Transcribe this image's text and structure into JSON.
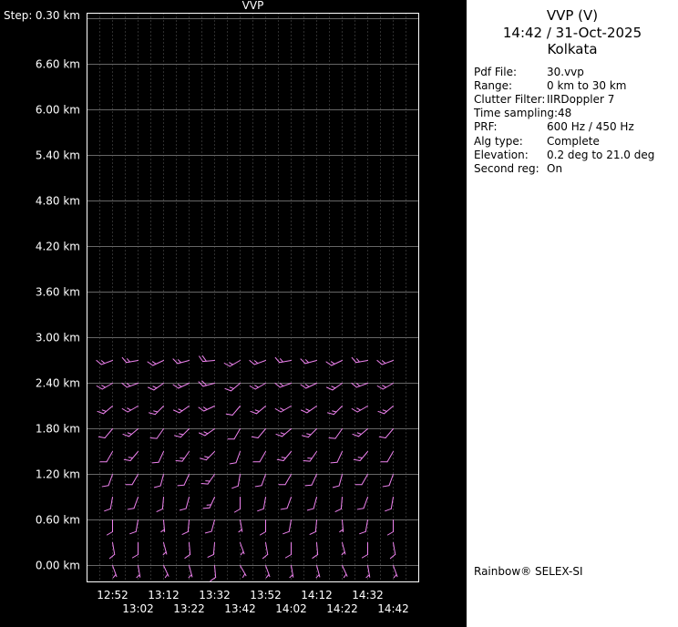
{
  "right_panel": {
    "title": "VVP (V)",
    "datetime": "14:42 / 31-Oct-2025",
    "station": "Kolkata",
    "info": {
      "rows": [
        {
          "label": "Pdf File:",
          "value": "30.vvp"
        },
        {
          "label": "Range:",
          "value": "0 km to 30 km"
        },
        {
          "label": "Clutter Filter:",
          "value": "IIRDoppler 7"
        },
        {
          "label": "Time sampling:",
          "value": "48"
        },
        {
          "label": "PRF:",
          "value": "600 Hz / 450 Hz"
        },
        {
          "label": "Alg type:",
          "value": "Complete"
        },
        {
          "label": "Elevation:",
          "value": "0.2 deg to 21.0 deg"
        },
        {
          "label": "Second reg:",
          "value": "On"
        }
      ]
    },
    "footer": "Rainbow® SELEX-SI"
  },
  "chart_data": {
    "type": "wind-barb-profile",
    "title": "VVP",
    "step_label": "Step:",
    "step_value": "0.30 km",
    "y_unit": "km",
    "y_ticks_km": [
      6.6,
      6.0,
      5.4,
      4.8,
      4.2,
      3.6,
      3.0,
      2.4,
      1.8,
      1.2,
      0.6,
      0.0
    ],
    "ylim_km": [
      -0.2,
      7.3
    ],
    "grid": {
      "horizontal_step_km": 0.6,
      "vertical_step_minutes": 5,
      "grid_on": true
    },
    "x_times": [
      "12:52",
      "13:02",
      "13:12",
      "13:22",
      "13:32",
      "13:42",
      "13:52",
      "14:02",
      "14:12",
      "14:22",
      "14:32",
      "14:42"
    ],
    "x_step_minutes": 10,
    "barb_color": "#f083f0",
    "barb_units": "each barb = [direction_deg, speed_kt] (estimated)",
    "series": [
      {
        "height_km": 0.0,
        "barbs": [
          [
            160,
            5
          ],
          [
            170,
            7
          ],
          [
            155,
            4
          ],
          [
            165,
            6
          ],
          [
            175,
            8
          ],
          [
            150,
            3
          ],
          [
            160,
            5
          ],
          [
            170,
            7
          ],
          [
            165,
            6
          ],
          [
            155,
            4
          ],
          [
            170,
            7
          ],
          [
            160,
            5
          ]
        ]
      },
      {
        "height_km": 0.3,
        "barbs": [
          [
            170,
            8
          ],
          [
            180,
            10
          ],
          [
            165,
            7
          ],
          [
            175,
            9
          ],
          [
            185,
            11
          ],
          [
            160,
            6
          ],
          [
            170,
            8
          ],
          [
            180,
            10
          ],
          [
            175,
            9
          ],
          [
            165,
            7
          ],
          [
            180,
            10
          ],
          [
            170,
            8
          ]
        ]
      },
      {
        "height_km": 0.6,
        "barbs": [
          [
            180,
            8
          ],
          [
            190,
            10
          ],
          [
            175,
            7
          ],
          [
            185,
            9
          ],
          [
            195,
            11
          ],
          [
            170,
            6
          ],
          [
            180,
            8
          ],
          [
            190,
            10
          ],
          [
            185,
            9
          ],
          [
            175,
            7
          ],
          [
            190,
            10
          ],
          [
            180,
            8
          ]
        ]
      },
      {
        "height_km": 0.9,
        "barbs": [
          [
            190,
            10
          ],
          [
            200,
            12
          ],
          [
            185,
            9
          ],
          [
            195,
            11
          ],
          [
            205,
            13
          ],
          [
            180,
            8
          ],
          [
            190,
            10
          ],
          [
            200,
            12
          ],
          [
            195,
            11
          ],
          [
            185,
            9
          ],
          [
            200,
            12
          ],
          [
            190,
            10
          ]
        ]
      },
      {
        "height_km": 1.2,
        "barbs": [
          [
            200,
            10
          ],
          [
            210,
            12
          ],
          [
            195,
            9
          ],
          [
            205,
            11
          ],
          [
            215,
            13
          ],
          [
            190,
            8
          ],
          [
            200,
            10
          ],
          [
            210,
            12
          ],
          [
            205,
            11
          ],
          [
            195,
            9
          ],
          [
            210,
            12
          ],
          [
            200,
            10
          ]
        ]
      },
      {
        "height_km": 1.5,
        "barbs": [
          [
            210,
            12
          ],
          [
            220,
            14
          ],
          [
            205,
            11
          ],
          [
            215,
            13
          ],
          [
            225,
            15
          ],
          [
            200,
            10
          ],
          [
            210,
            12
          ],
          [
            220,
            14
          ],
          [
            215,
            13
          ],
          [
            205,
            11
          ],
          [
            220,
            14
          ],
          [
            210,
            12
          ]
        ]
      },
      {
        "height_km": 1.8,
        "barbs": [
          [
            220,
            12
          ],
          [
            230,
            14
          ],
          [
            215,
            11
          ],
          [
            225,
            13
          ],
          [
            235,
            15
          ],
          [
            210,
            10
          ],
          [
            220,
            12
          ],
          [
            230,
            14
          ],
          [
            225,
            13
          ],
          [
            215,
            11
          ],
          [
            230,
            14
          ],
          [
            220,
            12
          ]
        ]
      },
      {
        "height_km": 2.1,
        "barbs": [
          [
            230,
            14
          ],
          [
            240,
            16
          ],
          [
            225,
            13
          ],
          [
            235,
            15
          ],
          [
            245,
            17
          ],
          [
            220,
            12
          ],
          [
            230,
            14
          ],
          [
            240,
            16
          ],
          [
            235,
            15
          ],
          [
            225,
            13
          ],
          [
            240,
            16
          ],
          [
            230,
            14
          ]
        ]
      },
      {
        "height_km": 2.4,
        "barbs": [
          [
            240,
            15
          ],
          [
            250,
            17
          ],
          [
            235,
            14
          ],
          [
            245,
            16
          ],
          [
            255,
            18
          ],
          [
            230,
            13
          ],
          [
            240,
            15
          ],
          [
            250,
            17
          ],
          [
            245,
            16
          ],
          [
            235,
            14
          ],
          [
            250,
            17
          ],
          [
            240,
            15
          ]
        ]
      },
      {
        "height_km": 2.7,
        "barbs": [
          [
            250,
            15
          ],
          [
            260,
            17
          ],
          [
            245,
            14
          ],
          [
            255,
            16
          ],
          [
            265,
            18
          ],
          [
            240,
            13
          ],
          [
            250,
            15
          ],
          [
            260,
            17
          ],
          [
            255,
            16
          ],
          [
            245,
            14
          ],
          [
            260,
            17
          ],
          [
            250,
            15
          ]
        ]
      }
    ]
  },
  "colors": {
    "background": "#000000",
    "panel": "#ffffff",
    "grid": "#666666",
    "frame": "#ffffff",
    "text_light": "#ffffff",
    "text_dark": "#000000",
    "barbs": "#f083f0"
  }
}
